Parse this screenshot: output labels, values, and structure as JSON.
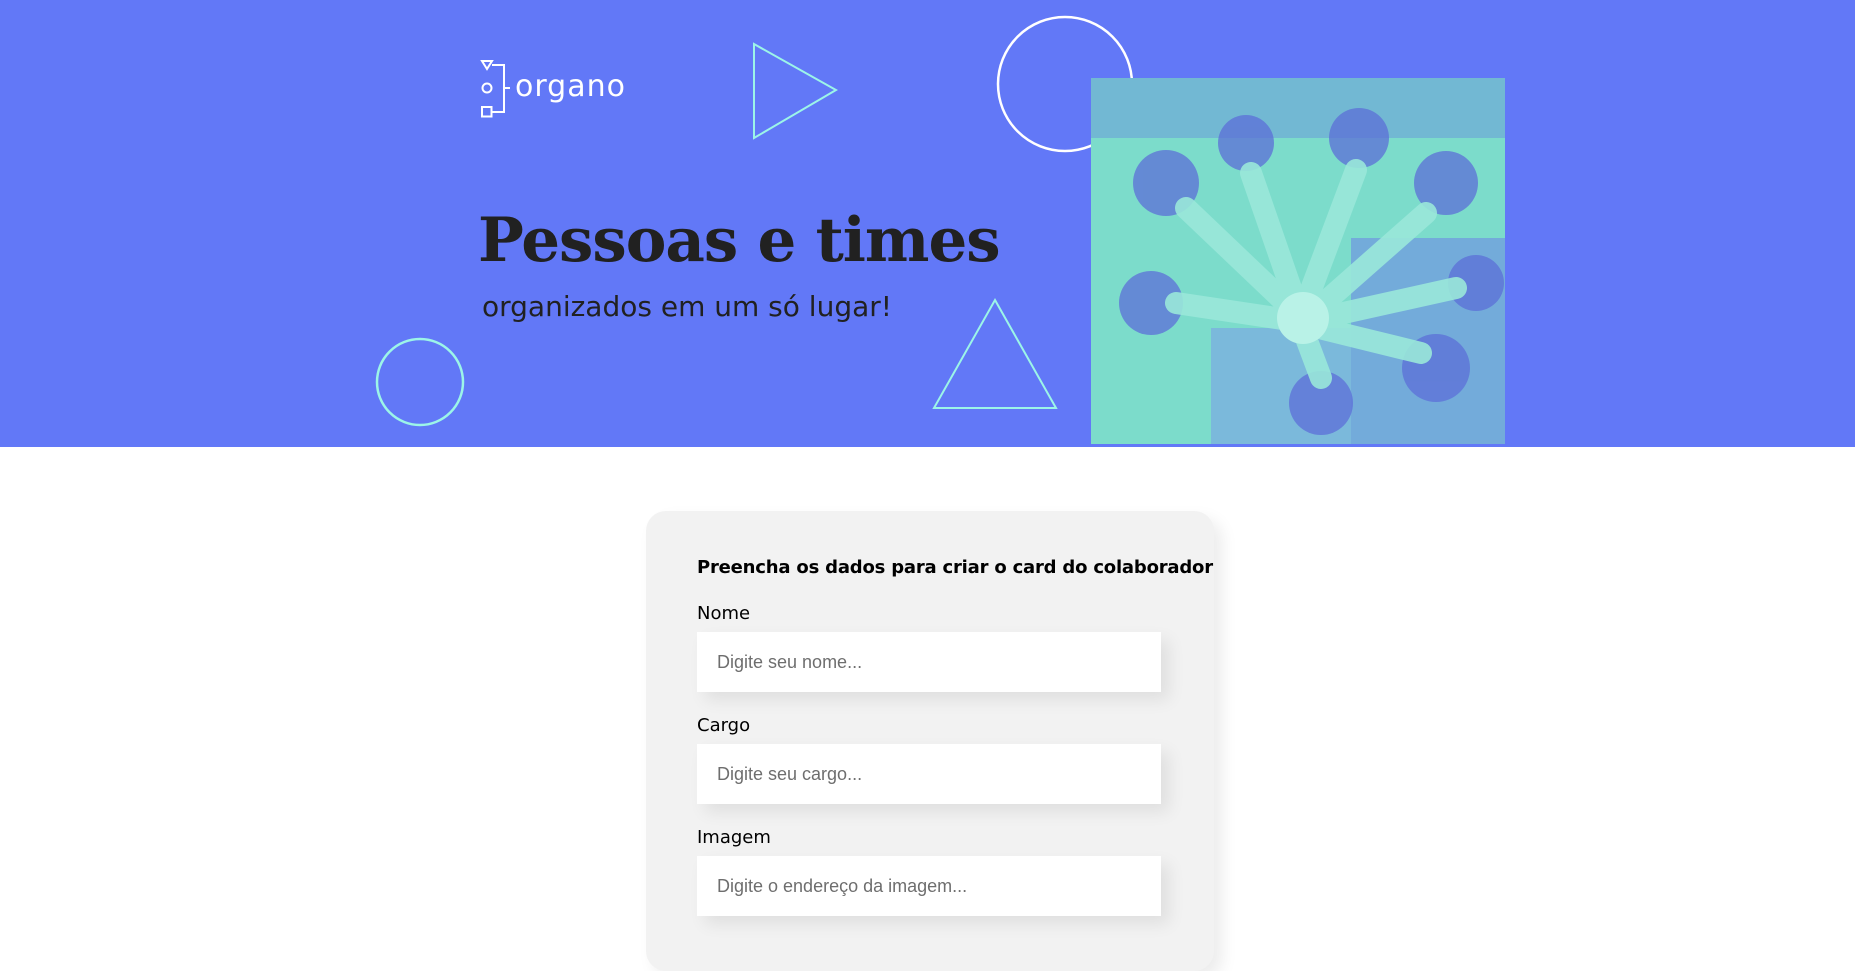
{
  "banner": {
    "logo_text": "organo",
    "headline": "Pessoas e times",
    "subheadline": "organizados em um só lugar!",
    "photo_alt": "Equipe unindo as mãos em círculo",
    "colors": {
      "background": "#6278F7",
      "accent": "#7FE0CE",
      "shape_outline": "#9CF5E8"
    }
  },
  "form": {
    "title": "Preencha os dados para criar o card do colaborador",
    "fields": [
      {
        "label": "Nome",
        "placeholder": "Digite seu nome...",
        "value": ""
      },
      {
        "label": "Cargo",
        "placeholder": "Digite seu cargo...",
        "value": ""
      },
      {
        "label": "Imagem",
        "placeholder": "Digite o endereço da imagem...",
        "value": ""
      }
    ]
  }
}
